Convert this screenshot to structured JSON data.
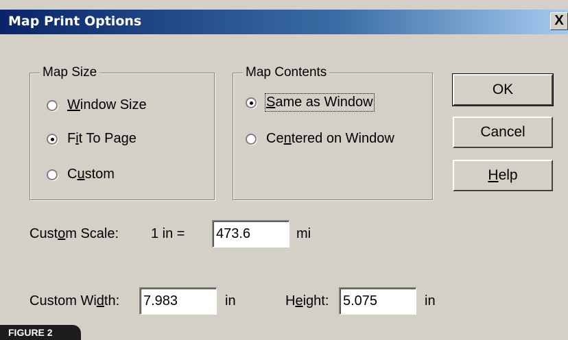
{
  "window": {
    "title": "Map Print Options",
    "close_label": "X"
  },
  "map_size": {
    "legend": "Map Size",
    "options": [
      {
        "pre": "",
        "ul": "W",
        "post": "indow Size",
        "checked": false
      },
      {
        "pre": "F",
        "ul": "i",
        "post": "t To Page",
        "checked": true
      },
      {
        "pre": "C",
        "ul": "u",
        "post": "stom",
        "checked": false
      }
    ]
  },
  "map_contents": {
    "legend": "Map Contents",
    "options": [
      {
        "pre": "",
        "ul": "S",
        "post": "ame as Window",
        "checked": true
      },
      {
        "pre": "Ce",
        "ul": "n",
        "post": "tered on Window",
        "checked": false
      }
    ]
  },
  "buttons": {
    "ok": "OK",
    "cancel": "Cancel",
    "help_ul": "H",
    "help_rest": "elp"
  },
  "custom_scale": {
    "label_pre": "Cust",
    "label_ul": "o",
    "label_post": "m Scale:",
    "prefix": "1 in =",
    "value": "473.6",
    "unit": "mi"
  },
  "custom_width": {
    "label_pre": "Custom Wi",
    "label_ul": "d",
    "label_post": "th:",
    "value": "7.983",
    "unit": "in"
  },
  "height": {
    "label_pre": "H",
    "label_ul": "e",
    "label_post": "ight:",
    "value": "5.075",
    "unit": "in"
  },
  "figure_tab": "FIGURE 2"
}
